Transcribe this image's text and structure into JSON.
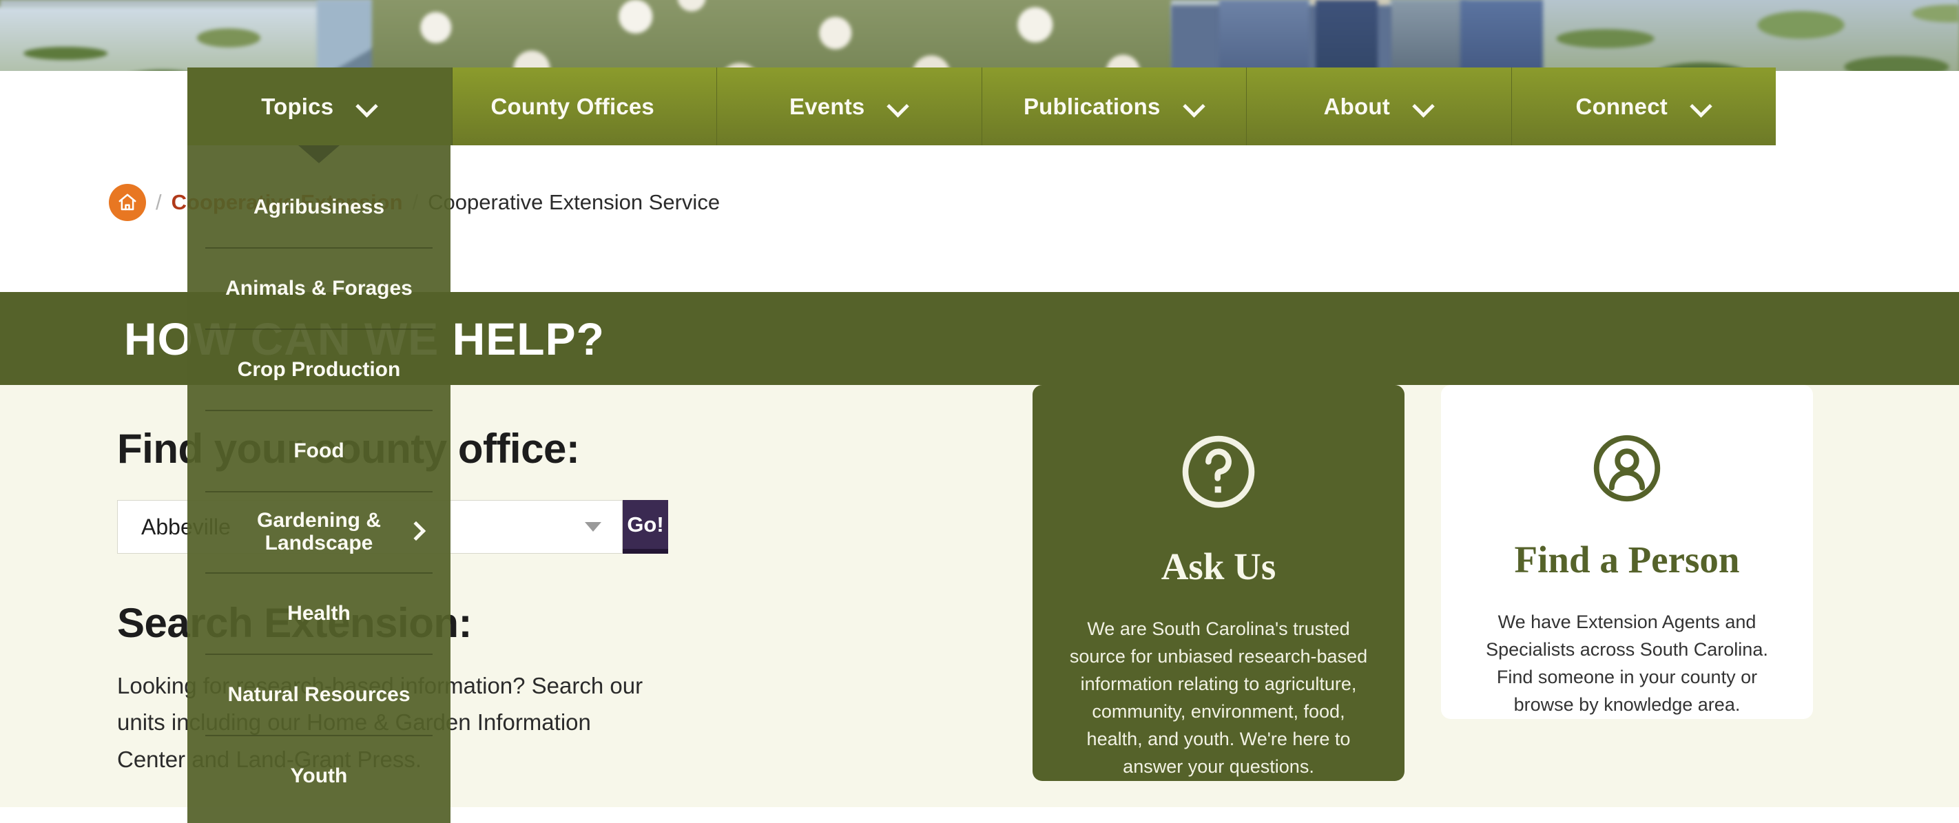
{
  "colors": {
    "nav_green": "#8b9b2c",
    "nav_green_active": "#5a682a",
    "banner_green": "#55622a",
    "dropdown_green": "#546129",
    "page_bg": "#f7f7ea",
    "breadcrumb_link": "#b03a1a",
    "home_badge": "#e87722",
    "go_button": "#3b2a52"
  },
  "nav": {
    "items": [
      {
        "label": "Topics",
        "has_chevron": true,
        "active": true,
        "icon": "chevron-down-icon"
      },
      {
        "label": "County Offices",
        "has_chevron": false,
        "active": false,
        "icon": ""
      },
      {
        "label": "Events",
        "has_chevron": true,
        "active": false,
        "icon": "chevron-down-icon"
      },
      {
        "label": "Publications",
        "has_chevron": true,
        "active": false,
        "icon": "chevron-down-icon"
      },
      {
        "label": "About",
        "has_chevron": true,
        "active": false,
        "icon": "chevron-down-icon"
      },
      {
        "label": "Connect",
        "has_chevron": true,
        "active": false,
        "icon": "chevron-down-icon"
      }
    ]
  },
  "dropdown": {
    "parent": "Topics",
    "items": [
      {
        "label": "Agribusiness",
        "has_submenu": false
      },
      {
        "label": "Animals & Forages",
        "has_submenu": false
      },
      {
        "label": "Crop Production",
        "has_submenu": false
      },
      {
        "label": "Food",
        "has_submenu": false
      },
      {
        "label": "Gardening & Landscape",
        "has_submenu": true
      },
      {
        "label": "Health",
        "has_submenu": false
      },
      {
        "label": "Natural Resources",
        "has_submenu": false
      },
      {
        "label": "Youth",
        "has_submenu": false
      }
    ]
  },
  "breadcrumb": {
    "home_icon": "home-icon",
    "separator": "/",
    "link": "Cooperative Extension",
    "current": "Cooperative Extension Service"
  },
  "banner": {
    "title": "HOW CAN WE HELP?"
  },
  "county": {
    "heading": "Find your county office:",
    "selected": "Abbeville",
    "go_label": "Go!",
    "caret_icon": "caret-down-icon"
  },
  "search": {
    "heading": "Search Extension:",
    "body": "Looking for research-based information? Search our units including our Home & Garden Information Center and Land-Grant Press."
  },
  "cards": [
    {
      "id": "ask-us",
      "icon": "question-mark-circle-icon",
      "title": "Ask Us",
      "text": "We are South Carolina's trusted source for unbiased research-based information relating to agriculture, community, environment, food, health, and youth. We're here to answer your questions."
    },
    {
      "id": "find-a-person",
      "icon": "person-circle-icon",
      "title": "Find a Person",
      "text": "We have Extension Agents and Specialists across South Carolina. Find someone in your county or browse by knowledge area."
    }
  ]
}
